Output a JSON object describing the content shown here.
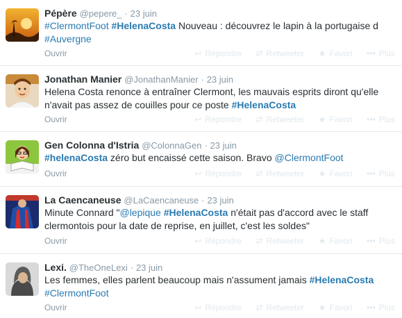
{
  "actions": {
    "reply": "Répondre",
    "retweet": "Retweeter",
    "favorite": "Favori",
    "more": "Plus",
    "open": "Ouvrir"
  },
  "icons": {
    "reply": "reply-icon",
    "retweet": "retweet-icon",
    "favorite": "star-icon",
    "more": "more-dots-icon"
  },
  "colors": {
    "link": "#2a7ab0",
    "meta": "#8899a6",
    "action_idle": "#e1e8ed"
  },
  "tweets": [
    {
      "fullname": "Pépère",
      "username": "@pepere_",
      "date": "23 juin",
      "segments": [
        {
          "t": "#ClermontFoot",
          "k": "hashtag"
        },
        {
          "t": " ",
          "k": "text"
        },
        {
          "t": "#HelenaCosta",
          "k": "hashtag-hl"
        },
        {
          "t": " Nouveau : découvrez le lapin à la portugaise d ",
          "k": "text"
        },
        {
          "t": "#Auvergne",
          "k": "hashtag"
        }
      ]
    },
    {
      "fullname": "Jonathan Manier",
      "username": "@JonathanManier",
      "date": "23 juin",
      "segments": [
        {
          "t": "Helena Costa renonce à entraîner Clermont, les mauvais esprits diront qu'elle n'avait pas assez de couilles pour ce poste ",
          "k": "text"
        },
        {
          "t": "#HelenaCosta",
          "k": "hashtag-hl"
        }
      ]
    },
    {
      "fullname": "Gen Colonna d'Istria",
      "username": "@ColonnaGen",
      "date": "23 juin",
      "segments": [
        {
          "t": "#helenaCosta",
          "k": "hashtag-hl"
        },
        {
          "t": " zéro but encaissé cette saison. Bravo ",
          "k": "text"
        },
        {
          "t": "@ClermontFoot",
          "k": "mention"
        }
      ]
    },
    {
      "fullname": "La Caencaneuse",
      "username": "@LaCaencaneuse",
      "date": "23 juin",
      "segments": [
        {
          "t": "Minute Connard \"",
          "k": "text"
        },
        {
          "t": "@lepique",
          "k": "mention"
        },
        {
          "t": " ",
          "k": "text"
        },
        {
          "t": "#HelenaCosta",
          "k": "hashtag-hl"
        },
        {
          "t": " n'était pas d'accord avec le staff clermontois pour la date de reprise, en juillet, c'est les soldes\"",
          "k": "text"
        }
      ]
    },
    {
      "fullname": "Lexi.",
      "username": "@TheOneLexi",
      "date": "23 juin",
      "segments": [
        {
          "t": "Les femmes, elles parlent beaucoup mais n'assument jamais ",
          "k": "text"
        },
        {
          "t": "#HelenaCosta",
          "k": "hashtag-hl"
        },
        {
          "t": " ",
          "k": "text"
        },
        {
          "t": "#ClermontFoot",
          "k": "hashtag"
        }
      ]
    }
  ]
}
